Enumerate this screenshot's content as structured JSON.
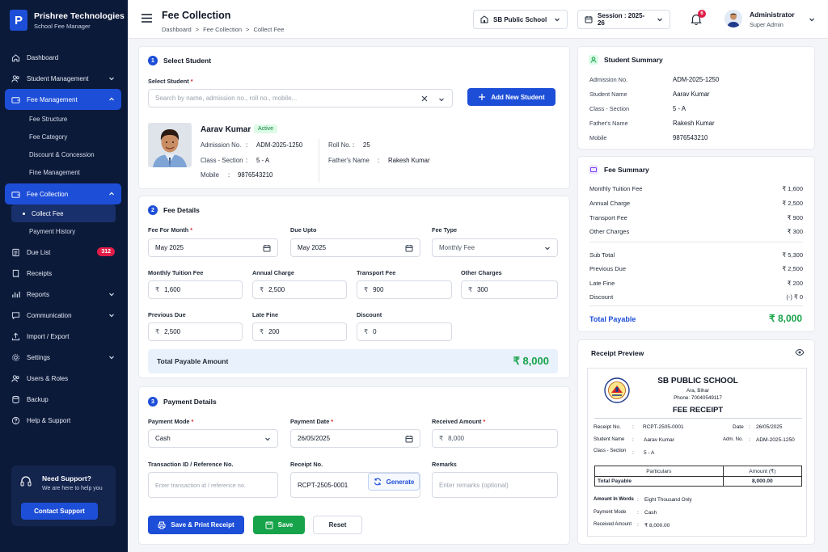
{
  "app": {
    "name": "Prishree Technologies",
    "subtitle": "School Fee Manager",
    "logo": "P"
  },
  "sidebar": {
    "items": [
      {
        "label": "Dashboard",
        "icon": "home-icon"
      },
      {
        "label": "Student Management",
        "icon": "users-icon"
      },
      {
        "label": "Fee Management",
        "icon": "wallet-icon"
      },
      {
        "label": "Fee Collection",
        "icon": "wallet-icon"
      },
      {
        "label": "Due List",
        "badge": "312"
      },
      {
        "label": "Receipts"
      },
      {
        "label": "Reports"
      },
      {
        "label": "Communication"
      },
      {
        "label": "Import / Export"
      },
      {
        "label": "Settings"
      },
      {
        "label": "Users & Roles"
      },
      {
        "label": "Backup"
      },
      {
        "label": "Help & Support"
      }
    ],
    "fee_management_sub": [
      "Fee Structure",
      "Fee Category",
      "Discount & Concession",
      "Fine Management"
    ],
    "fee_collection_sub": [
      "Collect Fee",
      "Payment History"
    ],
    "support": {
      "title": "Need Support?",
      "text": "We are here to help you",
      "button": "Contact Support"
    }
  },
  "header": {
    "title": "Fee Collection",
    "breadcrumb": [
      "Dashboard",
      ">",
      "Fee Collection",
      ">",
      "Collect Fee"
    ],
    "school": "SB Public School",
    "session": "Session : 2025-26",
    "notifications": "6",
    "user": {
      "name": "Administrator",
      "role": "Super Admin"
    }
  },
  "select_student": {
    "step": "1",
    "title": "Select Student",
    "label": "Select Student",
    "placeholder": "Search by name, admission no., roll no., mobile...",
    "add_button": "Add New Student",
    "student": {
      "name": "Aarav Kumar",
      "status": "Active",
      "admission_label": "Admission No.",
      "admission": "ADM-2025-1250",
      "roll_label": "Roll No.",
      "roll": "25",
      "class_label": "Class - Section",
      "class": "5 - A",
      "father_label": "Father's Name",
      "father": "Rakesh Kumar",
      "mobile_label": "Mobile",
      "mobile": "9876543210",
      "sep": ":"
    }
  },
  "fee_details": {
    "step": "2",
    "title": "Fee Details",
    "month_label": "Fee For Month",
    "month": "May 2025",
    "due_label": "Due Upto",
    "due": "May 2025",
    "type_label": "Fee Type",
    "type": "Monthly Fee",
    "currency": "₹",
    "fields": [
      {
        "label": "Monthly Tuition Fee",
        "value": "1,600"
      },
      {
        "label": "Annual Charge",
        "value": "2,500"
      },
      {
        "label": "Transport Fee",
        "value": "900"
      },
      {
        "label": "Other Charges",
        "value": "300"
      },
      {
        "label": "Previous Due",
        "value": "2,500"
      },
      {
        "label": "Late Fine",
        "value": "200"
      },
      {
        "label": "Discount",
        "value": "0"
      }
    ],
    "total_label": "Total Payable Amount",
    "total": "₹ 8,000"
  },
  "payment": {
    "step": "3",
    "title": "Payment Details",
    "mode_label": "Payment Mode",
    "mode": "Cash",
    "date_label": "Payment Date",
    "date": "26/05/2025",
    "received_label": "Received Amount",
    "received": "8,000",
    "txn_label": "Transaction ID / Reference No.",
    "txn_placeholder": "Enter transaction id / reference no.",
    "receipt_label": "Receipt No.",
    "receipt": "RCPT-2505-0001",
    "generate": "Generate",
    "remarks_label": "Remarks",
    "remarks_placeholder": "Enter remarks (optional)",
    "btn_print": "Save & Print Receipt",
    "btn_save": "Save",
    "btn_reset": "Reset"
  },
  "student_summary": {
    "title": "Student Summary",
    "rows": [
      {
        "label": "Admission No.",
        "value": "ADM-2025-1250"
      },
      {
        "label": "Student Name",
        "value": "Aarav Kumar"
      },
      {
        "label": "Class - Section",
        "value": "5 - A"
      },
      {
        "label": "Father's Name",
        "value": "Rakesh Kumar"
      },
      {
        "label": "Mobile",
        "value": "9876543210"
      }
    ]
  },
  "fee_summary": {
    "title": "Fee Summary",
    "rows": [
      {
        "label": "Monthly Tuition Fee",
        "value": "₹ 1,600"
      },
      {
        "label": "Annual Charge",
        "value": "₹ 2,500"
      },
      {
        "label": "Transport Fee",
        "value": "₹ 900"
      },
      {
        "label": "Other Charges",
        "value": "₹ 300"
      },
      {
        "label": "Sub Total",
        "value": "₹ 5,300"
      },
      {
        "label": "Previous Due",
        "value": "₹ 2,500"
      },
      {
        "label": "Late Fine",
        "value": "₹ 200"
      },
      {
        "label": "Discount",
        "value": "(-) ₹ 0"
      }
    ],
    "total_label": "Total Payable",
    "total": "₹ 8,000"
  },
  "receipt": {
    "title": "Receipt Preview",
    "school": "SB PUBLIC SCHOOL",
    "address": "Ara, Bihar",
    "phone": "Phone: 70040549117",
    "heading": "FEE RECEIPT",
    "receipt_no_label": "Receipt No.",
    "receipt_no": "RCPT-2505-0001",
    "date_label": "Date",
    "date": "26/05/2025",
    "student_label": "Student Name",
    "student": "Aarav Kumar",
    "adm_label": "Adm. No.",
    "adm": "ADM-2025-1250",
    "class_label": "Class - Section",
    "class": "5 - A",
    "col1": "Particulars",
    "col2": "Amount (₹)",
    "row_label": "Total Payable",
    "row_value": "8,000.00",
    "words_label": "Amount In Words",
    "words": "Eight Thousand Only",
    "mode_label": "Payment Mode",
    "mode": "Cash",
    "received_label": "Received Amount",
    "received": "₹ 8,000.00",
    "sep": ":"
  },
  "colors": {
    "primary": "#1d4ed8",
    "sidebar": "#0c1a3a",
    "success": "#16a34a",
    "danger": "#e11d48"
  }
}
